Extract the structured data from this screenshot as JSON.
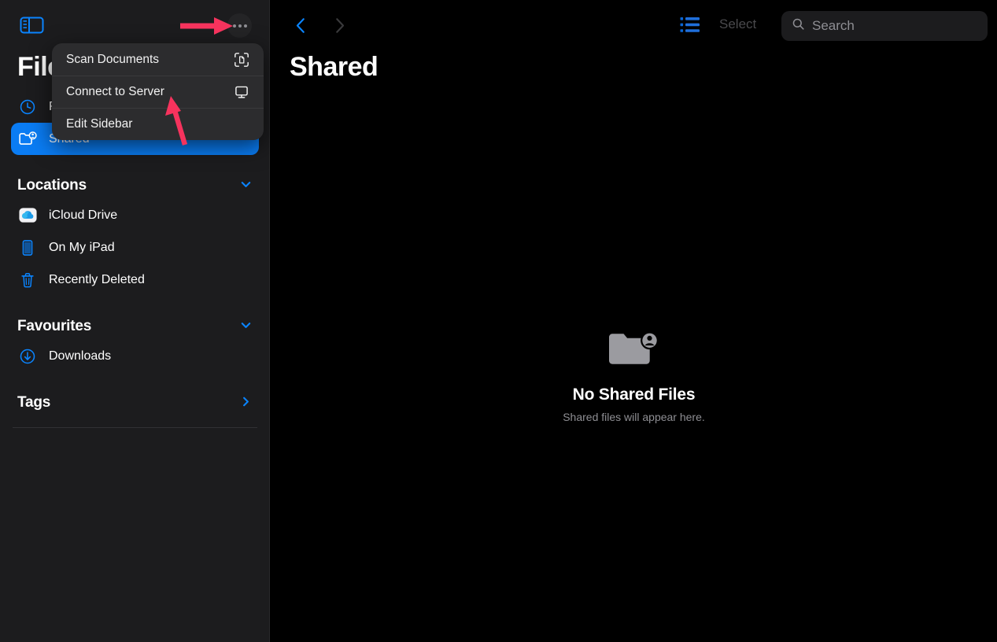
{
  "app": {
    "sidebar_title": "Files",
    "main_title": "Shared",
    "accent_blue": "#0a84ff",
    "selection_blue": "#0a7cf3",
    "annotation_color": "#f6335d",
    "sidebar_bg": "#1c1c1e",
    "main_bg": "#000000",
    "menu_bg": "#2c2c2e"
  },
  "sidebar": {
    "toggle_icon": "sidebar-toggle-icon",
    "more_icon": "ellipsis-circle-icon",
    "items": [
      {
        "label": "Recents",
        "icon": "clock-icon",
        "selected": false
      },
      {
        "label": "Shared",
        "icon": "folder-person-icon",
        "selected": true
      }
    ],
    "sections": [
      {
        "title": "Locations",
        "chevron": "chevron-down-icon",
        "items": [
          {
            "label": "iCloud Drive",
            "icon": "icloud-drive-icon"
          },
          {
            "label": "On My iPad",
            "icon": "ipad-icon"
          },
          {
            "label": "Recently Deleted",
            "icon": "trash-icon"
          }
        ]
      },
      {
        "title": "Favourites",
        "chevron": "chevron-down-icon",
        "items": [
          {
            "label": "Downloads",
            "icon": "download-circle-icon"
          }
        ]
      },
      {
        "title": "Tags",
        "chevron": "chevron-right-icon",
        "items": []
      }
    ]
  },
  "menu": {
    "items": [
      {
        "label": "Scan Documents",
        "icon": "document-scanner-icon"
      },
      {
        "label": "Connect to Server",
        "icon": "display-monitor-icon"
      },
      {
        "label": "Edit Sidebar",
        "icon": "none"
      }
    ]
  },
  "toolbar": {
    "back_icon": "chevron-left-icon",
    "forward_icon": "chevron-right-icon",
    "list_view_icon": "list-view-icon",
    "select_label": "Select",
    "search_icon": "search-icon",
    "search_placeholder": "Search",
    "search_value": ""
  },
  "empty_state": {
    "icon": "shared-folder-icon",
    "title": "No Shared Files",
    "subtitle": "Shared files will appear here."
  }
}
